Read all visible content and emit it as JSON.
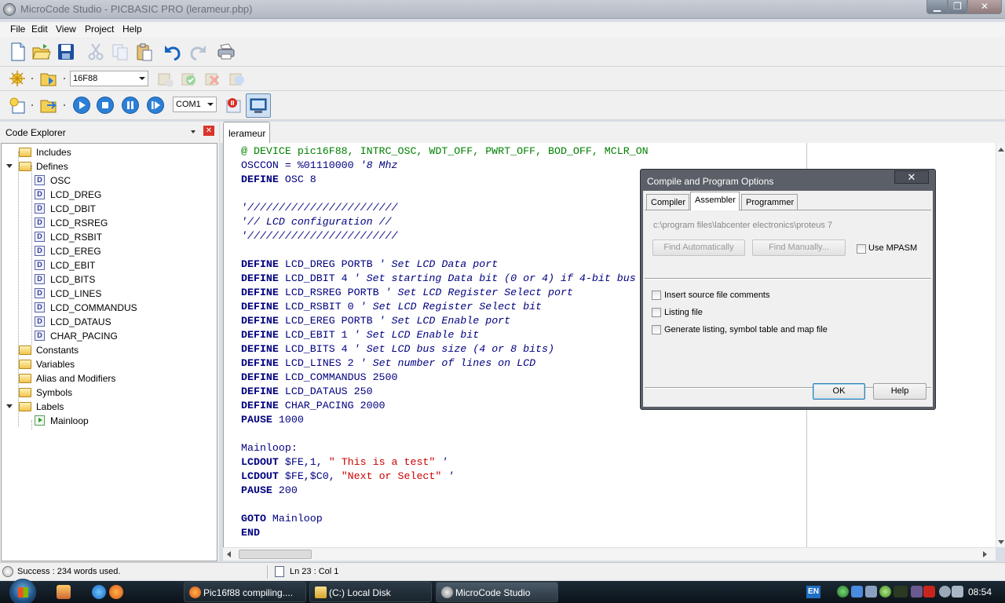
{
  "window": {
    "title": "MicroCode Studio - PICBASIC PRO (lerameur.pbp)"
  },
  "menu": [
    "File",
    "Edit",
    "View",
    "Project",
    "Help"
  ],
  "toolbar": {
    "device": "16F88",
    "port": "COM1"
  },
  "explorer": {
    "title": "Code Explorer",
    "tree": [
      {
        "label": "Includes",
        "kind": "folder",
        "level": 0
      },
      {
        "label": "Defines",
        "kind": "folder",
        "level": 0,
        "expanded": true
      },
      {
        "label": "OSC",
        "kind": "define",
        "level": 1
      },
      {
        "label": "LCD_DREG",
        "kind": "define",
        "level": 1
      },
      {
        "label": "LCD_DBIT",
        "kind": "define",
        "level": 1
      },
      {
        "label": "LCD_RSREG",
        "kind": "define",
        "level": 1
      },
      {
        "label": "LCD_RSBIT",
        "kind": "define",
        "level": 1
      },
      {
        "label": "LCD_EREG",
        "kind": "define",
        "level": 1
      },
      {
        "label": "LCD_EBIT",
        "kind": "define",
        "level": 1
      },
      {
        "label": "LCD_BITS",
        "kind": "define",
        "level": 1
      },
      {
        "label": "LCD_LINES",
        "kind": "define",
        "level": 1
      },
      {
        "label": "LCD_COMMANDUS",
        "kind": "define",
        "level": 1
      },
      {
        "label": "LCD_DATAUS",
        "kind": "define",
        "level": 1
      },
      {
        "label": "CHAR_PACING",
        "kind": "define",
        "level": 1
      },
      {
        "label": "Constants",
        "kind": "folder",
        "level": 0
      },
      {
        "label": "Variables",
        "kind": "folder",
        "level": 0
      },
      {
        "label": "Alias and Modifiers",
        "kind": "folder",
        "level": 0
      },
      {
        "label": "Symbols",
        "kind": "folder",
        "level": 0
      },
      {
        "label": "Labels",
        "kind": "folder",
        "level": 0,
        "expanded": true
      },
      {
        "label": "Mainloop",
        "kind": "label",
        "level": 1
      }
    ]
  },
  "editor": {
    "tab": "lerameur",
    "lines": [
      [
        [
          "dir",
          "@ DEVICE pic16F88, INTRC_OSC, WDT_OFF, PWRT_OFF, BOD_OFF, MCLR_ON"
        ]
      ],
      [
        [
          "plain",
          "OSCCON = %01110000 "
        ],
        [
          "cmt",
          "'8 Mhz"
        ]
      ],
      [
        [
          "kw",
          "DEFINE"
        ],
        [
          "plain",
          " OSC 8"
        ]
      ],
      [],
      [
        [
          "cmt",
          "'////////////////////////"
        ]
      ],
      [
        [
          "cmt",
          "'// LCD configuration //"
        ]
      ],
      [
        [
          "cmt",
          "'////////////////////////"
        ]
      ],
      [],
      [
        [
          "kw",
          "DEFINE"
        ],
        [
          "plain",
          " LCD_DREG PORTB "
        ],
        [
          "cmt",
          "' Set LCD Data port"
        ]
      ],
      [
        [
          "kw",
          "DEFINE"
        ],
        [
          "plain",
          " LCD_DBIT 4 "
        ],
        [
          "cmt",
          "' Set starting Data bit (0 or 4) if 4-bit bus"
        ]
      ],
      [
        [
          "kw",
          "DEFINE"
        ],
        [
          "plain",
          " LCD_RSREG PORTB "
        ],
        [
          "cmt",
          "' Set LCD Register Select port"
        ]
      ],
      [
        [
          "kw",
          "DEFINE"
        ],
        [
          "plain",
          " LCD_RSBIT 0 "
        ],
        [
          "cmt",
          "' Set LCD Register Select bit"
        ]
      ],
      [
        [
          "kw",
          "DEFINE"
        ],
        [
          "plain",
          " LCD_EREG PORTB "
        ],
        [
          "cmt",
          "' Set LCD Enable port"
        ]
      ],
      [
        [
          "kw",
          "DEFINE"
        ],
        [
          "plain",
          " LCD_EBIT 1 "
        ],
        [
          "cmt",
          "' Set LCD Enable bit"
        ]
      ],
      [
        [
          "kw",
          "DEFINE"
        ],
        [
          "plain",
          " LCD_BITS 4 "
        ],
        [
          "cmt",
          "' Set LCD bus size (4 or 8 bits)"
        ]
      ],
      [
        [
          "kw",
          "DEFINE"
        ],
        [
          "plain",
          " LCD_LINES 2 "
        ],
        [
          "cmt",
          "' Set number of lines on LCD"
        ]
      ],
      [
        [
          "kw",
          "DEFINE"
        ],
        [
          "plain",
          " LCD_COMMANDUS 2500"
        ]
      ],
      [
        [
          "kw",
          "DEFINE"
        ],
        [
          "plain",
          " LCD_DATAUS 250"
        ]
      ],
      [
        [
          "kw",
          "DEFINE"
        ],
        [
          "plain",
          " CHAR_PACING 2000"
        ]
      ],
      [
        [
          "kw",
          "PAUSE"
        ],
        [
          "plain",
          " 1000"
        ]
      ],
      [],
      [
        [
          "plain",
          "Mainloop:"
        ]
      ],
      [
        [
          "kw",
          "LCDOUT"
        ],
        [
          "plain",
          " $FE,1, "
        ],
        [
          "str",
          "\" This is a test\""
        ],
        [
          "plain",
          " "
        ],
        [
          "cmt",
          "'"
        ]
      ],
      [
        [
          "kw",
          "LCDOUT"
        ],
        [
          "plain",
          " $FE,$C0, "
        ],
        [
          "str",
          "\"Next or Select\""
        ],
        [
          "plain",
          " "
        ],
        [
          "cmt",
          "'"
        ]
      ],
      [
        [
          "kw",
          "PAUSE"
        ],
        [
          "plain",
          " 200"
        ]
      ],
      [],
      [
        [
          "kw",
          "GOTO"
        ],
        [
          "plain",
          " Mainloop"
        ]
      ],
      [
        [
          "kw",
          "END"
        ]
      ]
    ]
  },
  "status": {
    "message": "Success : 234 words used.",
    "position": "Ln 23 : Col 1"
  },
  "dialog": {
    "title": "Compile and Program Options",
    "tabs": [
      "Compiler",
      "Assembler",
      "Programmer"
    ],
    "active_tab": "Assembler",
    "path": "c:\\program files\\labcenter electronics\\proteus 7",
    "find_auto": "Find Automatically",
    "find_manual": "Find Manually...",
    "use_mpasm": "Use MPASM",
    "options": [
      "Insert source file comments",
      "Listing file",
      "Generate listing, symbol table and map file"
    ],
    "ok": "OK",
    "help": "Help",
    "close": "✕"
  },
  "taskbar": {
    "tasks": [
      "Pic16f88 compiling....",
      "(C:) Local Disk",
      "MicroCode Studio"
    ],
    "lang": "EN",
    "clock": "08:54"
  }
}
